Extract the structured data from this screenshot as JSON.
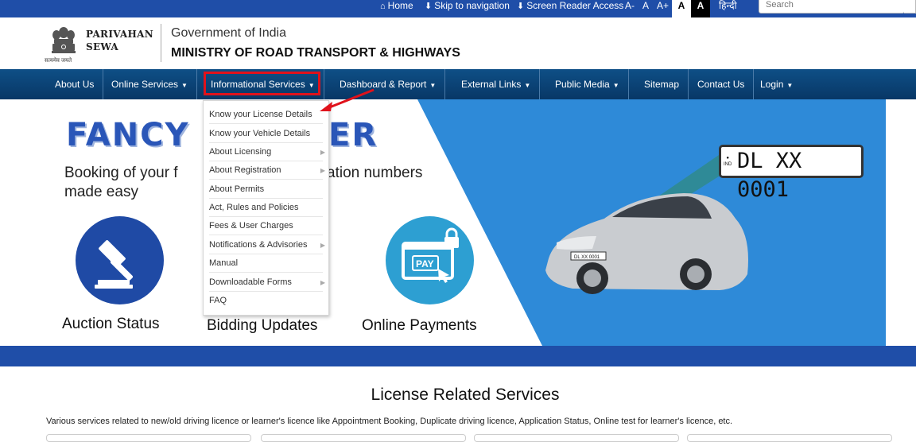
{
  "topbar": {
    "home": "Home",
    "skip": "Skip to navigation",
    "reader": "Screen Reader Access",
    "font_small": "A-",
    "font_normal": "A",
    "font_large": "A+",
    "contrast_light": "A",
    "contrast_dark": "A",
    "language": "हिन्दी",
    "search_placeholder": "Search"
  },
  "header": {
    "brand_line1": "PARIVAHAN",
    "brand_line2": "SEWA",
    "emblem_caption": "सत्यमेव जयते",
    "gov": "Government of India",
    "ministry": "MINISTRY OF ROAD TRANSPORT & HIGHWAYS"
  },
  "nav": {
    "items": [
      {
        "label": "About Us"
      },
      {
        "label": "Online Services"
      },
      {
        "label": "Informational Services"
      },
      {
        "label": "Dashboard & Report"
      },
      {
        "label": "External Links"
      },
      {
        "label": "Public Media"
      },
      {
        "label": "Sitemap"
      },
      {
        "label": "Contact Us"
      },
      {
        "label": "Login"
      }
    ]
  },
  "dropdown": {
    "items": [
      {
        "label": "Know your License Details"
      },
      {
        "label": "Know your Vehicle Details"
      },
      {
        "label": "About Licensing"
      },
      {
        "label": "About Registration"
      },
      {
        "label": "About Permits"
      },
      {
        "label": "Act, Rules and Policies"
      },
      {
        "label": "Fees & User Charges"
      },
      {
        "label": "Notifications & Advisories"
      },
      {
        "label": "Manual"
      },
      {
        "label": "Downloadable Forms"
      },
      {
        "label": "FAQ"
      }
    ]
  },
  "hero": {
    "title_left": "FANCY",
    "title_right": "ER",
    "subtitle_line1_left": "Booking of your f",
    "subtitle_line1_right": "ation numbers",
    "subtitle_line2": "made easy",
    "labels": [
      "Auction Status",
      "Bidding Updates",
      "Online Payments"
    ],
    "pay_text": "PAY",
    "plate_country": "IND",
    "plate_number": "DL XX 0001",
    "car_plate": "DL XX 0001"
  },
  "section": {
    "title": "License Related Services",
    "description": "Various services related to new/old driving licence or learner's licence like Appointment Booking, Duplicate driving licence, Application Status, Online test for learner's licence, etc."
  },
  "colors": {
    "brand_blue": "#1f4ea8",
    "nav_blue": "#0a4277",
    "highlight_red": "#e0121b",
    "circle_dark_blue": "#1f4aa5",
    "circle_light_blue": "#2d9fd2"
  }
}
